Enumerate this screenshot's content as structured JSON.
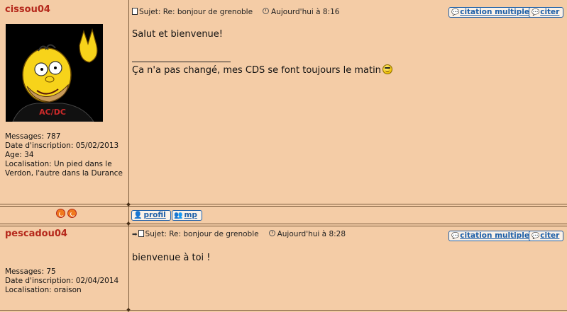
{
  "post1": {
    "username": "cissou04",
    "profile": {
      "messages": "Messages: 787",
      "inscription": "Date d'inscription: 05/02/2013",
      "age": "Age: 34",
      "localisation": "Localisation: Un pied dans le Verdon, l'autre dans la Durance"
    },
    "subject": "Sujet: Re: bonjour de grenoble",
    "time": "Aujourd'hui à 8:16",
    "body_line1": "Salut et bienvenue!",
    "signature": "Ça n'a pas changé, mes CDS se font toujours le matin",
    "avatar_text": "AC/DC"
  },
  "post2": {
    "username": "pescadou04",
    "profile": {
      "messages": "Messages: 75",
      "inscription": "Date d'inscription: 02/04/2014",
      "localisation": "Localisation: oraison"
    },
    "subject": "Sujet: Re: bonjour de grenoble",
    "time": "Aujourd'hui à 8:28",
    "body": "bienvenue à toi !"
  },
  "buttons": {
    "multi_quote": "citation multiple",
    "quote": "citer",
    "profile": "profil",
    "pm": "mp"
  },
  "icons": {
    "quote": "quote-bubble-icon",
    "doc": "document-icon",
    "clock": "clock-icon",
    "nav": "orange-circle-arrow-icon",
    "profile": "person-icon",
    "pm": "two-persons-icon"
  },
  "colors": {
    "background": "#f4cca6",
    "username": "#b5281b",
    "link": "#1d5fa8",
    "border": "#7a5a3a"
  }
}
